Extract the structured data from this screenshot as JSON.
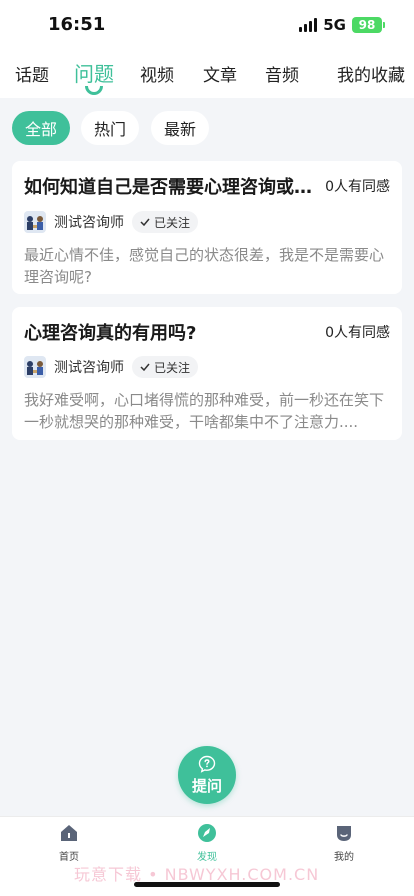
{
  "status_bar": {
    "time": "16:51",
    "network": "5G",
    "battery": "98"
  },
  "tabs": [
    {
      "label": "话题"
    },
    {
      "label": "问题",
      "active": true
    },
    {
      "label": "视频"
    },
    {
      "label": "文章"
    },
    {
      "label": "音频"
    },
    {
      "label": "我的收藏"
    }
  ],
  "filters": [
    {
      "label": "全部",
      "active": true
    },
    {
      "label": "热门"
    },
    {
      "label": "最新"
    }
  ],
  "questions": [
    {
      "title": "如何知道自己是否需要心理咨询或...",
      "agree_count": "0人有同感",
      "author": "测试咨询师",
      "follow_status": "已关注",
      "body": "最近心情不佳，感觉自己的状态很差，我是不是需要心理咨询呢?"
    },
    {
      "title": "心理咨询真的有用吗?",
      "agree_count": "0人有同感",
      "author": "测试咨询师",
      "follow_status": "已关注",
      "body": "我好难受啊，心口堵得慌的那种难受，前一秒还在笑下一秒就想哭的那种难受，干啥都集中不了注意力...."
    }
  ],
  "ask_button": {
    "label": "提问",
    "icon": "question-icon"
  },
  "bottom_nav": [
    {
      "label": "首页",
      "icon": "home-icon"
    },
    {
      "label": "发现",
      "icon": "compass-icon",
      "active": true
    },
    {
      "label": "我的",
      "icon": "profile-icon"
    }
  ],
  "watermark": "玩意下载 • NBWYXH.COM.CN",
  "colors": {
    "accent": "#3fc09a",
    "background": "#f3f5f8"
  }
}
